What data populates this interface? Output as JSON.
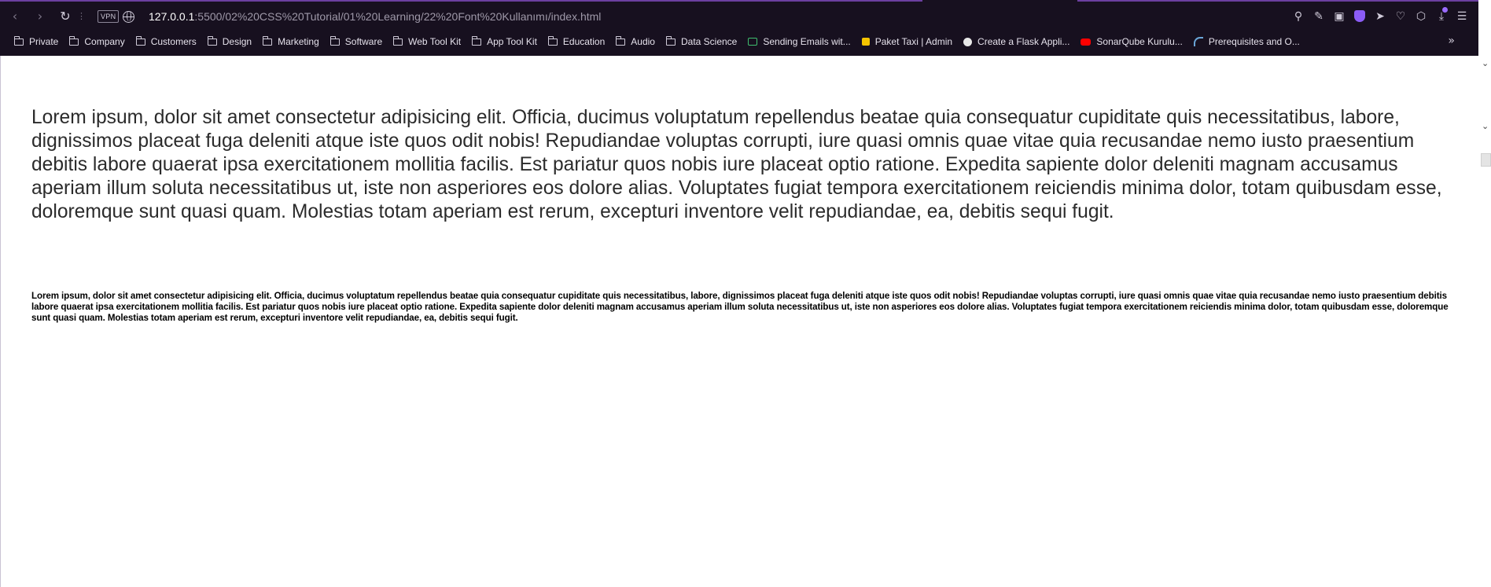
{
  "browser": {
    "vpn_label": "VPN",
    "url_host": "127.0.0.1",
    "url_path": ":5500/02%20CSS%20Tutorial/01%20Learning/22%20Font%20Kullanımı/index.html",
    "nav_icons": [
      "back-icon",
      "forward-icon",
      "reload-icon"
    ],
    "toolbar_icons": [
      "search-icon",
      "edit-icon",
      "camera-icon",
      "shield-icon",
      "send-icon",
      "heart-icon",
      "cube-icon",
      "download-icon",
      "menu-icon"
    ],
    "accent_color": "#6b3fa0",
    "background_color": "#17101f"
  },
  "bookmarks": [
    {
      "label": "Private",
      "icon": "folder-icon"
    },
    {
      "label": "Company",
      "icon": "folder-icon"
    },
    {
      "label": "Customers",
      "icon": "folder-icon"
    },
    {
      "label": "Design",
      "icon": "folder-icon"
    },
    {
      "label": "Marketing",
      "icon": "folder-icon"
    },
    {
      "label": "Software",
      "icon": "folder-icon"
    },
    {
      "label": "Web Tool Kit",
      "icon": "folder-icon"
    },
    {
      "label": "App Tool Kit",
      "icon": "folder-icon"
    },
    {
      "label": "Education",
      "icon": "folder-icon"
    },
    {
      "label": "Audio",
      "icon": "folder-icon"
    },
    {
      "label": "Data Science",
      "icon": "folder-icon"
    },
    {
      "label": "Sending Emails wit...",
      "icon": "mail-favicon"
    },
    {
      "label": "Paket Taxi | Admin",
      "icon": "taxi-favicon"
    },
    {
      "label": "Create a Flask Appli...",
      "icon": "flask-favicon"
    },
    {
      "label": "SonarQube Kurulu...",
      "icon": "youtube-favicon"
    },
    {
      "label": "Prerequisites and O...",
      "icon": "prereq-favicon"
    }
  ],
  "bookmarks_more": "»",
  "page": {
    "paragraph_1": "Lorem ipsum, dolor sit amet consectetur adipisicing elit. Officia, ducimus voluptatum repellendus beatae quia consequatur cupiditate quis necessitatibus, labore, dignissimos placeat fuga deleniti atque iste quos odit nobis! Repudiandae voluptas corrupti, iure quasi omnis quae vitae quia recusandae nemo iusto praesentium debitis labore quaerat ipsa exercitationem mollitia facilis. Est pariatur quos nobis iure placeat optio ratione. Expedita sapiente dolor deleniti magnam accusamus aperiam illum soluta necessitatibus ut, iste non asperiores eos dolore alias. Voluptates fugiat tempora exercitationem reiciendis minima dolor, totam quibusdam esse, doloremque sunt quasi quam. Molestias totam aperiam est rerum, excepturi inventore velit repudiandae, ea, debitis sequi fugit.",
    "paragraph_2": "Lorem ipsum, dolor sit amet consectetur adipisicing elit. Officia, ducimus voluptatum repellendus beatae quia consequatur cupiditate quis necessitatibus, labore, dignissimos placeat fuga deleniti atque iste quos odit nobis! Repudiandae voluptas corrupti, iure quasi omnis quae vitae quia recusandae nemo iusto praesentium debitis labore quaerat ipsa exercitationem mollitia facilis. Est pariatur quos nobis iure placeat optio ratione. Expedita sapiente dolor deleniti magnam accusamus aperiam illum soluta necessitatibus ut, iste non asperiores eos dolore alias. Voluptates fugiat tempora exercitationem reiciendis minima dolor, totam quibusdam esse, doloremque sunt quasi quam. Molestias totam aperiam est rerum, excepturi inventore velit repudiandae, ea, debitis sequi fugit."
  }
}
